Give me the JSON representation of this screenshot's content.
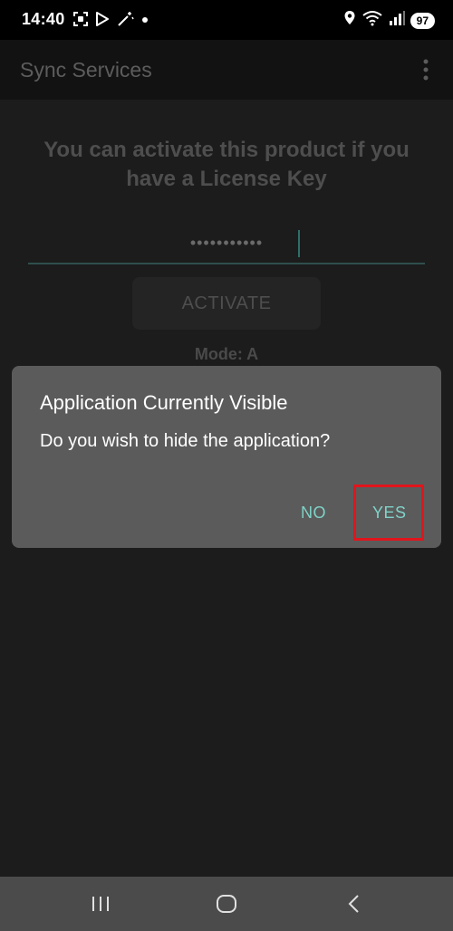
{
  "status_bar": {
    "time": "14:40",
    "battery": "97",
    "left_icons": [
      "screenshot-icon",
      "play-store-icon",
      "magic-wand-icon",
      "notification-dot-icon"
    ],
    "right_icons": [
      "location-icon",
      "wifi-icon",
      "signal-icon"
    ]
  },
  "app_bar": {
    "title": "Sync Services",
    "menu_icon": "overflow-menu-icon"
  },
  "main": {
    "heading": "You can activate this product if you have a License Key",
    "license_input_value": "•••••••••••",
    "activate_label": "ACTIVATE",
    "mode_label": "Mode: A"
  },
  "dialog": {
    "title": "Application Currently Visible",
    "message": "Do you wish to hide the application?",
    "no_label": "NO",
    "yes_label": "YES",
    "accent_color": "#7fd3c8",
    "highlight_color": "#e1151c"
  },
  "nav_bar": {
    "recent_icon": "recent-apps-icon",
    "home_icon": "home-icon",
    "back_icon": "back-icon"
  }
}
